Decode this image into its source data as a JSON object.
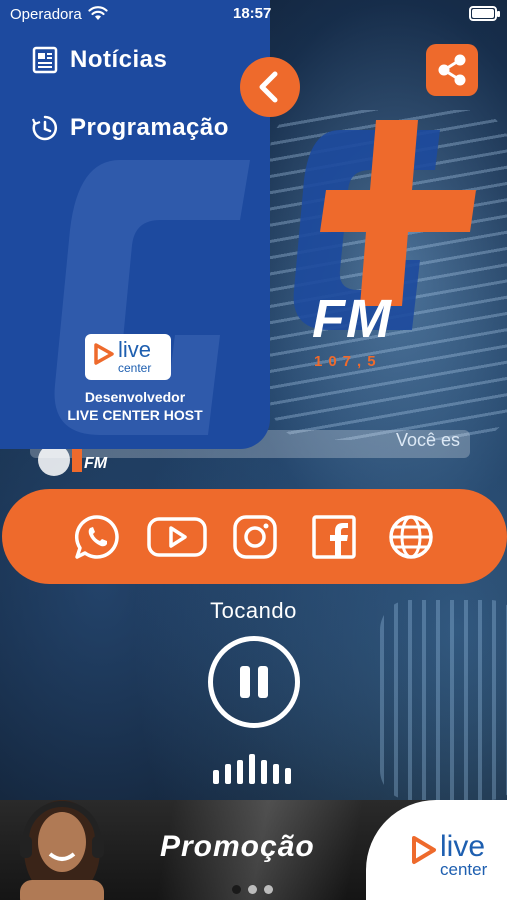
{
  "status_bar": {
    "carrier": "Operadora",
    "time": "18:57"
  },
  "drawer": {
    "menu": [
      {
        "label": "Notícias",
        "icon": "newspaper-icon"
      },
      {
        "label": "Programação",
        "icon": "clock-icon"
      }
    ],
    "developer_logo": {
      "live": "live",
      "center": "center"
    },
    "developer_title": "Desenvolvedor",
    "developer_name": "LIVE CENTER HOST"
  },
  "station": {
    "name": "FM",
    "frequency": "107,5"
  },
  "ticker": {
    "text": "Você es"
  },
  "social": [
    {
      "name": "whatsapp-icon"
    },
    {
      "name": "youtube-icon"
    },
    {
      "name": "instagram-icon"
    },
    {
      "name": "facebook-icon"
    },
    {
      "name": "globe-icon"
    }
  ],
  "player": {
    "status": "Tocando",
    "state": "playing"
  },
  "banner": {
    "promo": "Promoção",
    "logo_live": "live",
    "logo_center": "center",
    "page_index": 1,
    "page_count": 3
  },
  "colors": {
    "accent": "#ee6a2c",
    "drawer": "#1d4a9f",
    "brand_blue": "#1e5fb0"
  }
}
